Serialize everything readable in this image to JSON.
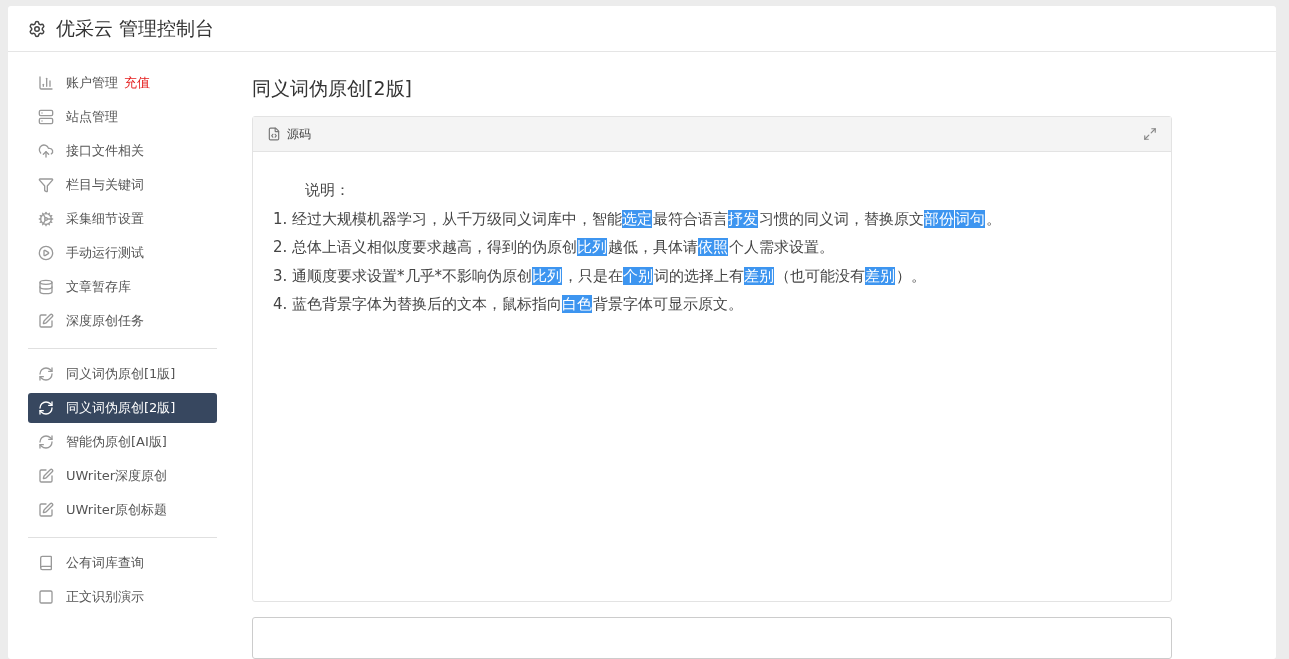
{
  "header": {
    "title": "优采云 管理控制台"
  },
  "sidebar": {
    "groups": [
      {
        "items": [
          {
            "label": "账户管理",
            "badge": "充值",
            "selected": false
          },
          {
            "label": "站点管理",
            "selected": false
          },
          {
            "label": "接口文件相关",
            "selected": false
          },
          {
            "label": "栏目与关键词",
            "selected": false
          },
          {
            "label": "采集细节设置",
            "selected": false
          },
          {
            "label": "手动运行测试",
            "selected": false
          },
          {
            "label": "文章暂存库",
            "selected": false
          },
          {
            "label": "深度原创任务",
            "selected": false
          }
        ]
      },
      {
        "items": [
          {
            "label": "同义词伪原创[1版]",
            "selected": false
          },
          {
            "label": "同义词伪原创[2版]",
            "selected": true
          },
          {
            "label": "智能伪原创[AI版]",
            "selected": false
          },
          {
            "label": "UWriter深度原创",
            "selected": false
          },
          {
            "label": "UWriter原创标题",
            "selected": false
          }
        ]
      },
      {
        "items": [
          {
            "label": "公有词库查询",
            "selected": false
          },
          {
            "label": "正文识别演示",
            "selected": false
          }
        ]
      }
    ]
  },
  "page_title": "同义词伪原创[2版]",
  "panel": {
    "tab": "源码",
    "intro": "说明：",
    "lines": [
      [
        {
          "text": "1. 经过大规模机器学习，从千万级同义词库中，智能",
          "highlight": false
        },
        {
          "text": "选定",
          "highlight": true
        },
        {
          "text": "最符合语言",
          "highlight": false
        },
        {
          "text": "抒发",
          "highlight": true
        },
        {
          "text": "习惯的同义词，替换原文",
          "highlight": false
        },
        {
          "text": "部份",
          "highlight": true
        },
        {
          "text": "词句",
          "highlight": true
        },
        {
          "text": "。",
          "highlight": false
        }
      ],
      [
        {
          "text": "2. 总体上语义相似度要求越高，得到的伪原创",
          "highlight": false
        },
        {
          "text": "比列",
          "highlight": true
        },
        {
          "text": "越低，具体请",
          "highlight": false
        },
        {
          "text": "依照",
          "highlight": true
        },
        {
          "text": "个人需求设置。",
          "highlight": false
        }
      ],
      [
        {
          "text": "3. 通顺度要求设置*几乎*不影响伪原创",
          "highlight": false
        },
        {
          "text": "比列",
          "highlight": true
        },
        {
          "text": "，只是在",
          "highlight": false
        },
        {
          "text": "个别",
          "highlight": true
        },
        {
          "text": "词的选择上有",
          "highlight": false
        },
        {
          "text": "差别",
          "highlight": true
        },
        {
          "text": "（也可能没有",
          "highlight": false
        },
        {
          "text": "差别",
          "highlight": true
        },
        {
          "text": "）。",
          "highlight": false
        }
      ],
      [
        {
          "text": "4. 蓝色背景字体为替换后的文本，鼠标指向",
          "highlight": false
        },
        {
          "text": "白色",
          "highlight": true
        },
        {
          "text": "背景字体可显示原文。",
          "highlight": false
        }
      ]
    ]
  }
}
